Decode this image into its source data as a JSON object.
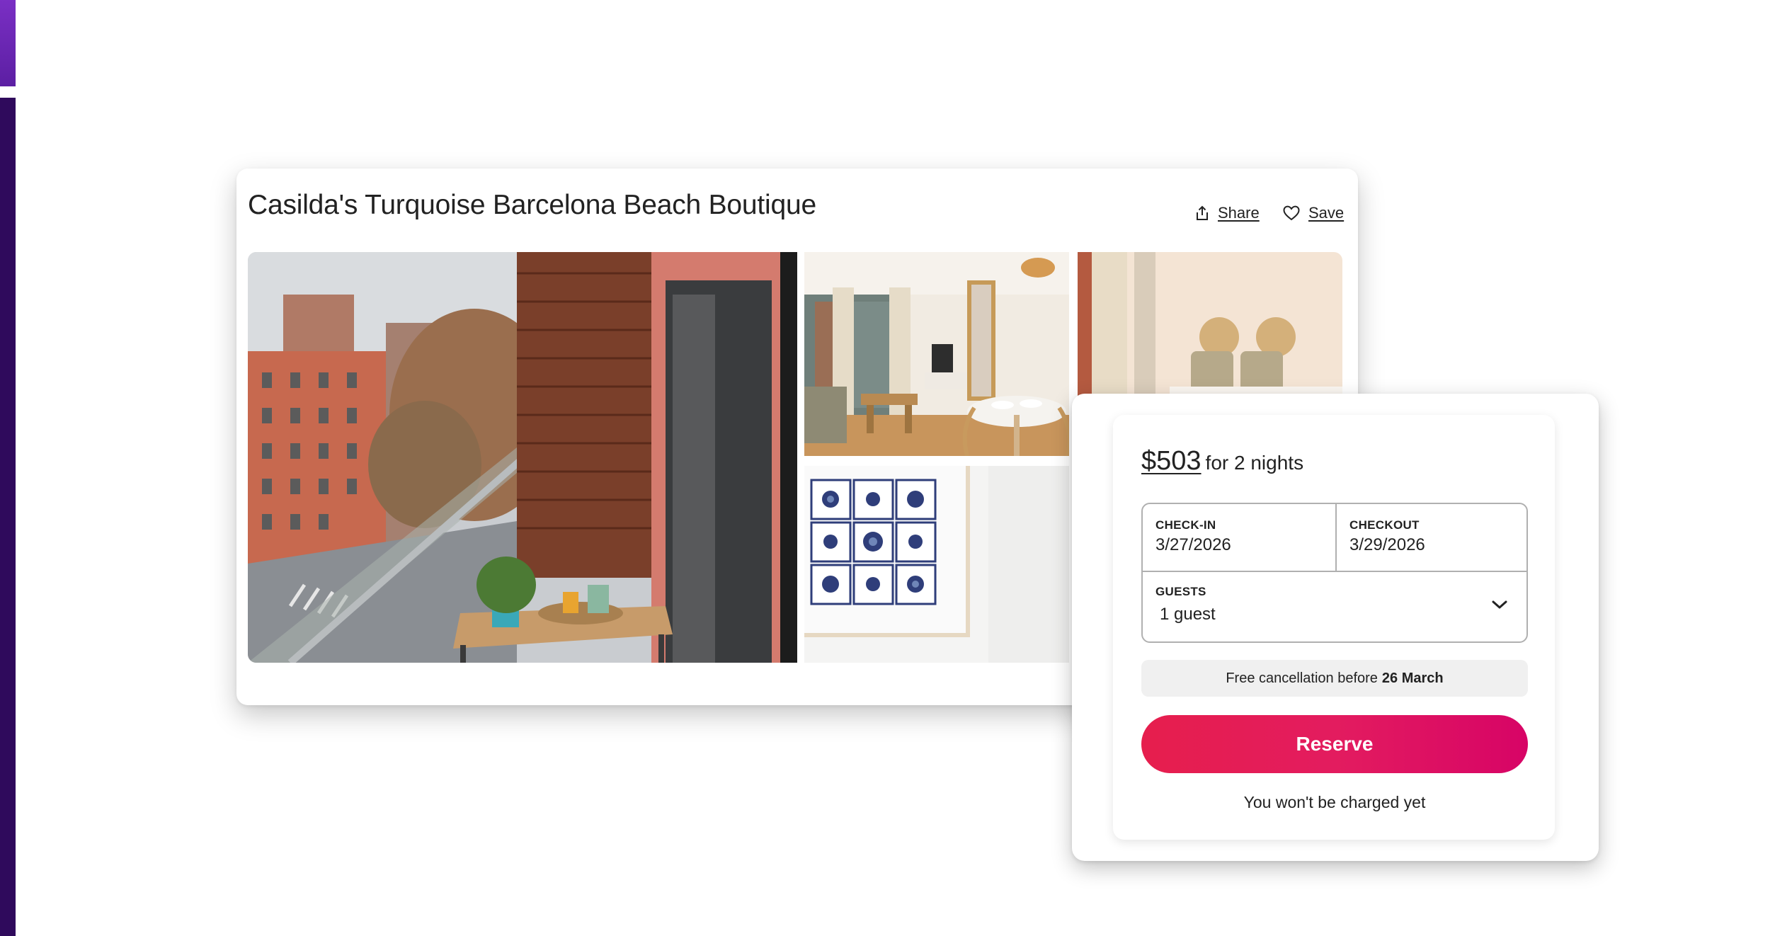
{
  "listing": {
    "title": "Casilda's Turquoise Barcelona Beach Boutique",
    "share_label": "Share",
    "save_label": "Save"
  },
  "gallery": {
    "photos": [
      {
        "subject": "balcony with street view"
      },
      {
        "subject": "living and dining room"
      },
      {
        "subject": "bedroom"
      },
      {
        "subject": "framed blue tile artwork"
      }
    ]
  },
  "booking": {
    "price": "$503",
    "price_suffix": "for 2 nights",
    "checkin_label": "CHECK-IN",
    "checkin_value": "3/27/2026",
    "checkout_label": "CHECKOUT",
    "checkout_value": "3/29/2026",
    "guests_label": "GUESTS",
    "guests_value": "1 guest",
    "cancel_text": "Free cancellation before",
    "cancel_date": "26 March",
    "reserve_label": "Reserve",
    "charge_note": "You won't be charged yet"
  },
  "colors": {
    "accent_purple": "#5c1fa3",
    "accent_dark_purple": "#2f0a5c",
    "reserve_gradient_start": "#e61e4d",
    "reserve_gradient_end": "#d70466",
    "text": "#222222"
  },
  "icons": [
    "share-icon",
    "heart-icon",
    "chevron-down-icon"
  ]
}
